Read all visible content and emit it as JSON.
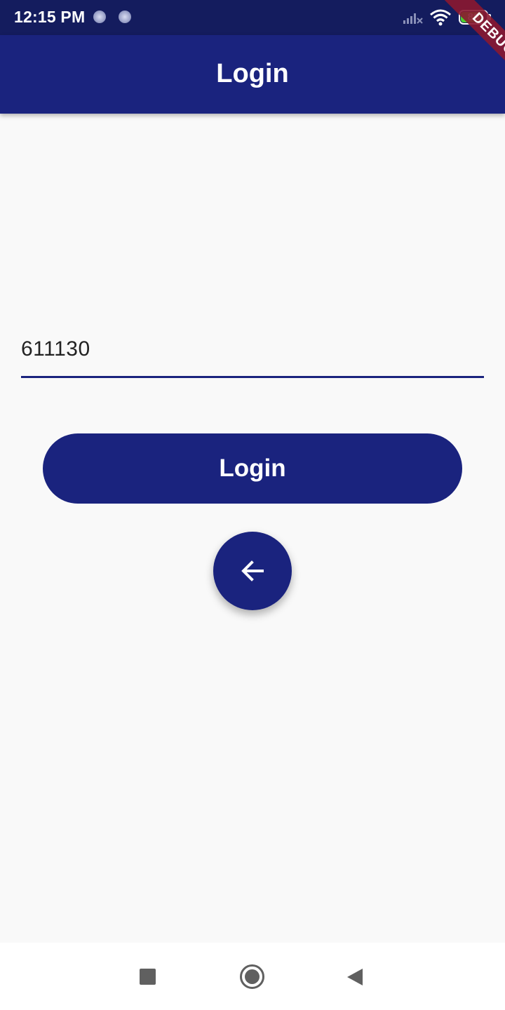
{
  "status_bar": {
    "time": "12:15 PM",
    "battery_level": "89",
    "battery_fraction": 0.89,
    "icons": [
      "notification-dot-icon",
      "notification-dot-icon",
      "signal-icon",
      "wifi-icon",
      "battery-icon"
    ]
  },
  "debug_banner": {
    "label": "DEBUG"
  },
  "app_bar": {
    "title": "Login"
  },
  "form": {
    "pin_value": "611130",
    "login_button_label": "Login",
    "back_button_icon": "arrow-back-icon"
  },
  "nav_bar": {
    "icons": [
      "recents-square-icon",
      "home-circle-icon",
      "back-triangle-icon"
    ]
  },
  "colors": {
    "primary": "#1a237e",
    "status_bar": "#141c5e",
    "background": "#f9f9f9",
    "debug_ribbon": "#8b1830",
    "battery_fill": "#4ccf2d"
  }
}
